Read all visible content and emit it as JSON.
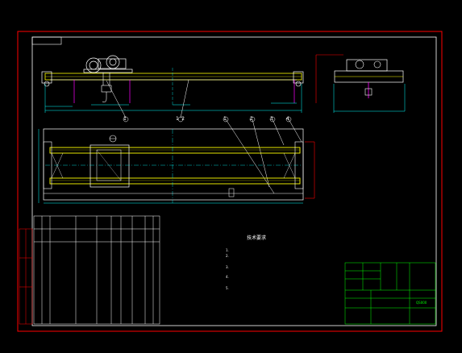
{
  "drawing": {
    "colors": {
      "background": "#000000",
      "frame": "#ff0000",
      "outline": "#ffffff",
      "girder": "#ffff00",
      "dimension": "#00ffff",
      "hidden": "#ff00ff",
      "centerline": "#00ffff",
      "title_block": "#00ff00"
    },
    "balloons": [
      "1",
      "1 2",
      "1",
      "2",
      "3",
      "4"
    ],
    "notes": {
      "title": "技术要求",
      "items": [
        "1.",
        "2.",
        "3.",
        "4.",
        "5."
      ]
    },
    "title_block": {
      "part_code": "QS000"
    }
  }
}
